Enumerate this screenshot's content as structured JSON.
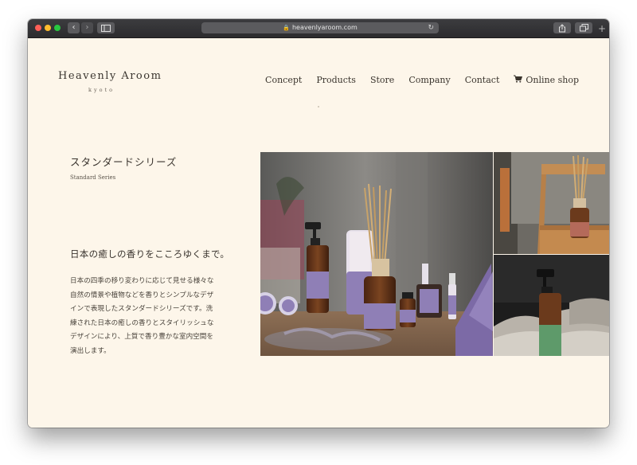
{
  "browser": {
    "url": "heavenlyaroom.com"
  },
  "brand": {
    "name": "Heavenly Aroom",
    "sub": "kyoto"
  },
  "nav": {
    "items": [
      "Concept",
      "Products",
      "Store",
      "Company",
      "Contact"
    ],
    "shop": "Online shop"
  },
  "section": {
    "title_jp": "スタンダードシリーズ",
    "title_en": "Standard Series",
    "tagline": "日本の癒しの香りをこころゆくまで。",
    "description": [
      "日本の四季の移り変わりに応じて見せる様々な",
      "自然の情景や植物などを香りとシンプルなデザ",
      "インで表現したスタンダードシリーズです。洗",
      "練された日本の癒しの香りとスタイリッシュな",
      "デザインにより、上質で香り豊かな室内空間を",
      "演出します。"
    ]
  },
  "colors": {
    "background": "#fdf6ea",
    "label_purple": "#8f7fb6",
    "bottle_amber": "#6b3a1c",
    "label_green": "#5e9a6a"
  },
  "icons": [
    "back-icon",
    "forward-icon",
    "sidebar-icon",
    "lock-icon",
    "reload-icon",
    "share-icon",
    "tabs-icon",
    "new-tab-icon",
    "cart-icon"
  ]
}
